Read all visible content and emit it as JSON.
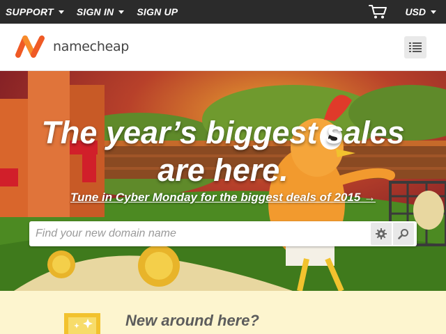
{
  "topbar": {
    "nav": [
      {
        "label": "SUPPORT",
        "has_menu": true
      },
      {
        "label": "SIGN IN",
        "has_menu": true
      },
      {
        "label": "SIGN UP",
        "has_menu": false
      }
    ],
    "cart_icon": "shopping-cart-icon",
    "currency": "USD"
  },
  "header": {
    "logo_text": "namecheap",
    "menu_icon": "hamburger-list-icon"
  },
  "hero": {
    "headline_line1": "The year’s biggest sales",
    "headline_line2": "are here.",
    "tagline": "Tune in Cyber Monday for the biggest deals of 2015 →",
    "search_placeholder": "Find your new domain name",
    "search_options_icon": "gear-icon",
    "search_icon": "magnifier-icon"
  },
  "promo": {
    "title": "New around here?",
    "icon": "sparkle-card-icon"
  },
  "colors": {
    "topbar_bg": "#2b2b2b",
    "brand_orange": "#ef5a25",
    "promo_bg": "#fdf5cf",
    "hero_bg": "#8a1e2a"
  }
}
